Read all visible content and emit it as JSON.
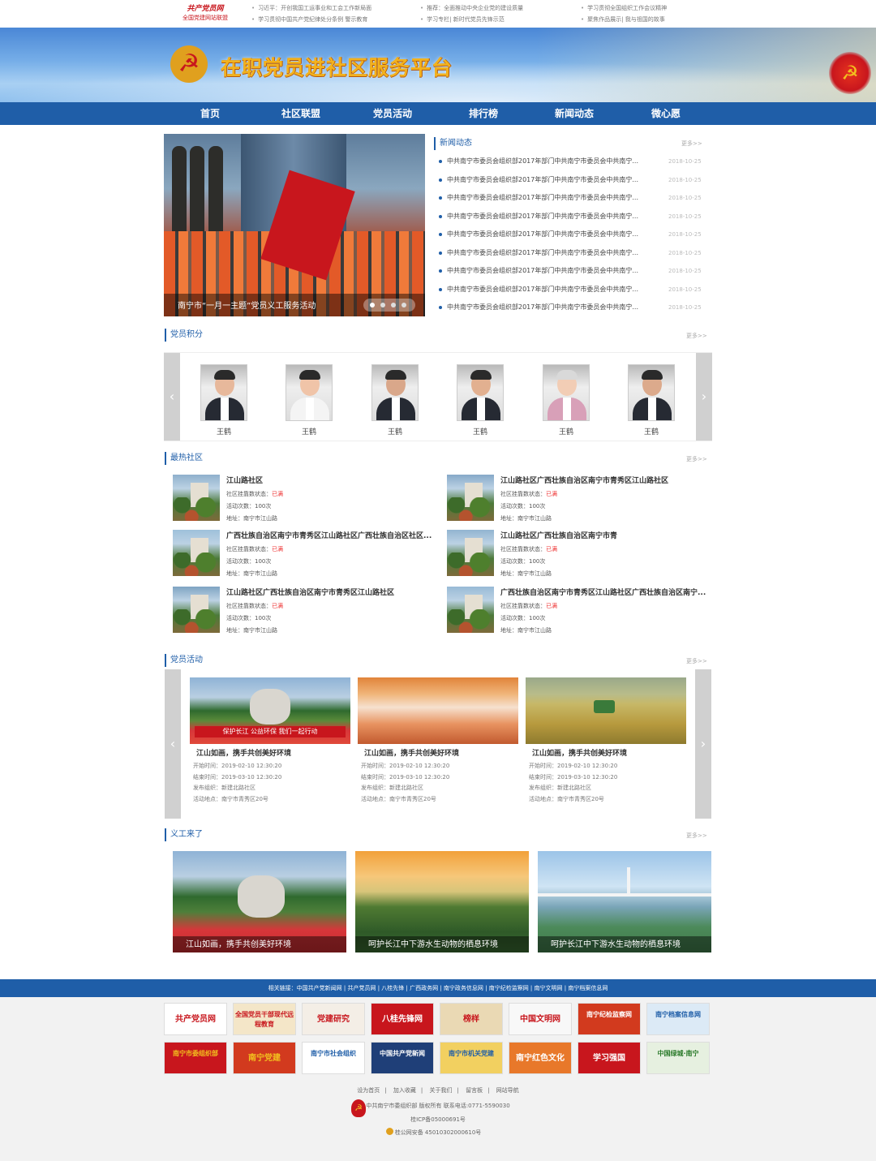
{
  "topbar": {
    "logo_line1": "共产党员网",
    "logo_line2": "全国党建网站联盟",
    "news": [
      "习近平：开创我国工运事业和工会工作新局面",
      "学习贯彻中国共产党纪律处分条例 警示教育",
      "推荐：全面推动中央企业党的建设质量",
      "学习专栏| 新时代党员先锋示范",
      "学习贯彻全国组织工作会议精神",
      "聚焦作品展示| 我与祖国的故事"
    ]
  },
  "banner": {
    "title": "在职党员进社区服务平台"
  },
  "nav": {
    "items": [
      "首页",
      "社区联盟",
      "党员活动",
      "排行榜",
      "新闻动态",
      "微心愿"
    ]
  },
  "slider": {
    "caption": "南宁市“一月一主题”党员义工服务活动"
  },
  "news": {
    "title": "新闻动态",
    "more": "更多>>",
    "items": [
      {
        "title": "中共南宁市委员会组织部2017年部门中共南宁市委员会中共南宁...",
        "date": "2018-10-25"
      },
      {
        "title": "中共南宁市委员会组织部2017年部门中共南宁市委员会中共南宁...",
        "date": "2018-10-25"
      },
      {
        "title": "中共南宁市委员会组织部2017年部门中共南宁市委员会中共南宁...",
        "date": "2018-10-25"
      },
      {
        "title": "中共南宁市委员会组织部2017年部门中共南宁市委员会中共南宁...",
        "date": "2018-10-25"
      },
      {
        "title": "中共南宁市委员会组织部2017年部门中共南宁市委员会中共南宁...",
        "date": "2018-10-25"
      },
      {
        "title": "中共南宁市委员会组织部2017年部门中共南宁市委员会中共南宁...",
        "date": "2018-10-25"
      },
      {
        "title": "中共南宁市委员会组织部2017年部门中共南宁市委员会中共南宁...",
        "date": "2018-10-25"
      },
      {
        "title": "中共南宁市委员会组织部2017年部门中共南宁市委员会中共南宁...",
        "date": "2018-10-25"
      },
      {
        "title": "中共南宁市委员会组织部2017年部门中共南宁市委员会中共南宁...",
        "date": "2018-10-25"
      }
    ]
  },
  "points": {
    "title": "党员积分",
    "more": "更多>>",
    "people": [
      "王鹤",
      "王鹤",
      "王鹤",
      "王鹤",
      "王鹤",
      "王鹤"
    ]
  },
  "community": {
    "title": "最热社区",
    "more": "更多>>",
    "status_label": "社区挂靠数状态：",
    "status_value": "已满",
    "count_label": "活动次数：",
    "count_value": "100次",
    "addr_label": "地址：",
    "addr_value": "南宁市江山路",
    "items": [
      "江山路社区",
      "江山路社区广西壮族自治区南宁市青秀区江山路社区",
      "广西壮族自治区南宁市青秀区江山路社区广西壮族自治区社区...",
      "江山路社区广西壮族自治区南宁市青",
      "江山路社区广西壮族自治区南宁市青秀区江山路社区",
      "广西壮族自治区南宁市青秀区江山路社区广西壮族自治区南宁..."
    ]
  },
  "activities": {
    "title": "党员活动",
    "more": "更多>>",
    "start_label": "开始时间：",
    "end_label": "结束时间：",
    "org_label": "发布组织：",
    "place_label": "活动地点：",
    "items": [
      {
        "title": "江山如画，携手共创美好环境",
        "start": "2019-02-10  12:30:20",
        "end": "2019-03-10  12:30:20",
        "org": "新建北路社区",
        "place": "南宁市青秀区20号",
        "banner": "保护长江 公益环保 我们一起行动"
      },
      {
        "title": "江山如画，携手共创美好环境",
        "start": "2019-02-10  12:30:20",
        "end": "2019-03-10  12:30:20",
        "org": "新建北路社区",
        "place": "南宁市青秀区20号"
      },
      {
        "title": "江山如画，携手共创美好环境",
        "start": "2019-02-10  12:30:20",
        "end": "2019-03-10  12:30:20",
        "org": "新建北路社区",
        "place": "南宁市青秀区20号"
      }
    ]
  },
  "volunteer": {
    "title": "义工来了",
    "more": "更多>>",
    "items": [
      "江山如画，携手共创美好环境",
      "呵护长江中下游水生动物的栖息环境",
      "呵护长江中下游水生动物的栖息环境"
    ]
  },
  "footer": {
    "related": "相关链接：中国共产党新闻网 | 共产党员网 | 八桂先锋 | 广西政务网 | 南宁政务信息网 | 南宁纪检监察网 | 南宁文明网 | 南宁档案信息网",
    "logos": [
      {
        "text": "共产党员网",
        "color": "#c8161d",
        "bg": "#ffffff"
      },
      {
        "text": "全国党员干部现代远程教育",
        "color": "#c8161d",
        "bg": "#f4e6c8"
      },
      {
        "text": "党建研究",
        "color": "#c8161d",
        "bg": "#f4eee6"
      },
      {
        "text": "八桂先锋网",
        "color": "#ffffff",
        "bg": "#c8161d"
      },
      {
        "text": "榜样",
        "color": "#c8161d",
        "bg": "#ead9b4"
      },
      {
        "text": "中国文明网",
        "color": "#c8161d",
        "bg": "#f8f8f8"
      },
      {
        "text": "南宁纪检监察网",
        "color": "#ffffff",
        "bg": "#d23a1e"
      },
      {
        "text": "南宁档案信息网",
        "color": "#1f5ea8",
        "bg": "#dceaf6"
      },
      {
        "text": "南宁市委组织部",
        "color": "#f2c01e",
        "bg": "#c8161d"
      },
      {
        "text": "南宁党建",
        "color": "#f2c01e",
        "bg": "#d23a1e"
      },
      {
        "text": "南宁市社会组织",
        "color": "#1f5ea8",
        "bg": "#ffffff"
      },
      {
        "text": "中国共产党新闻",
        "color": "#ffffff",
        "bg": "#1f3f78"
      },
      {
        "text": "南宁市机关党建",
        "color": "#1f5ea8",
        "bg": "#f2d060"
      },
      {
        "text": "南宁红色文化",
        "color": "#ffffff",
        "bg": "#e8782a"
      },
      {
        "text": "学习强国",
        "color": "#ffffff",
        "bg": "#c8161d"
      },
      {
        "text": "中国绿城·南宁",
        "color": "#2a7a2a",
        "bg": "#e6f0e0"
      }
    ],
    "links": [
      "设为首页",
      "加入收藏",
      "关于我们",
      "留言板",
      "网站导航"
    ],
    "copyright": "中共南宁市委组织部 版权所有 联系电话:0771-5590030",
    "icp": "桂ICP备05000691号",
    "police": "桂公网安备 45010302000610号"
  }
}
